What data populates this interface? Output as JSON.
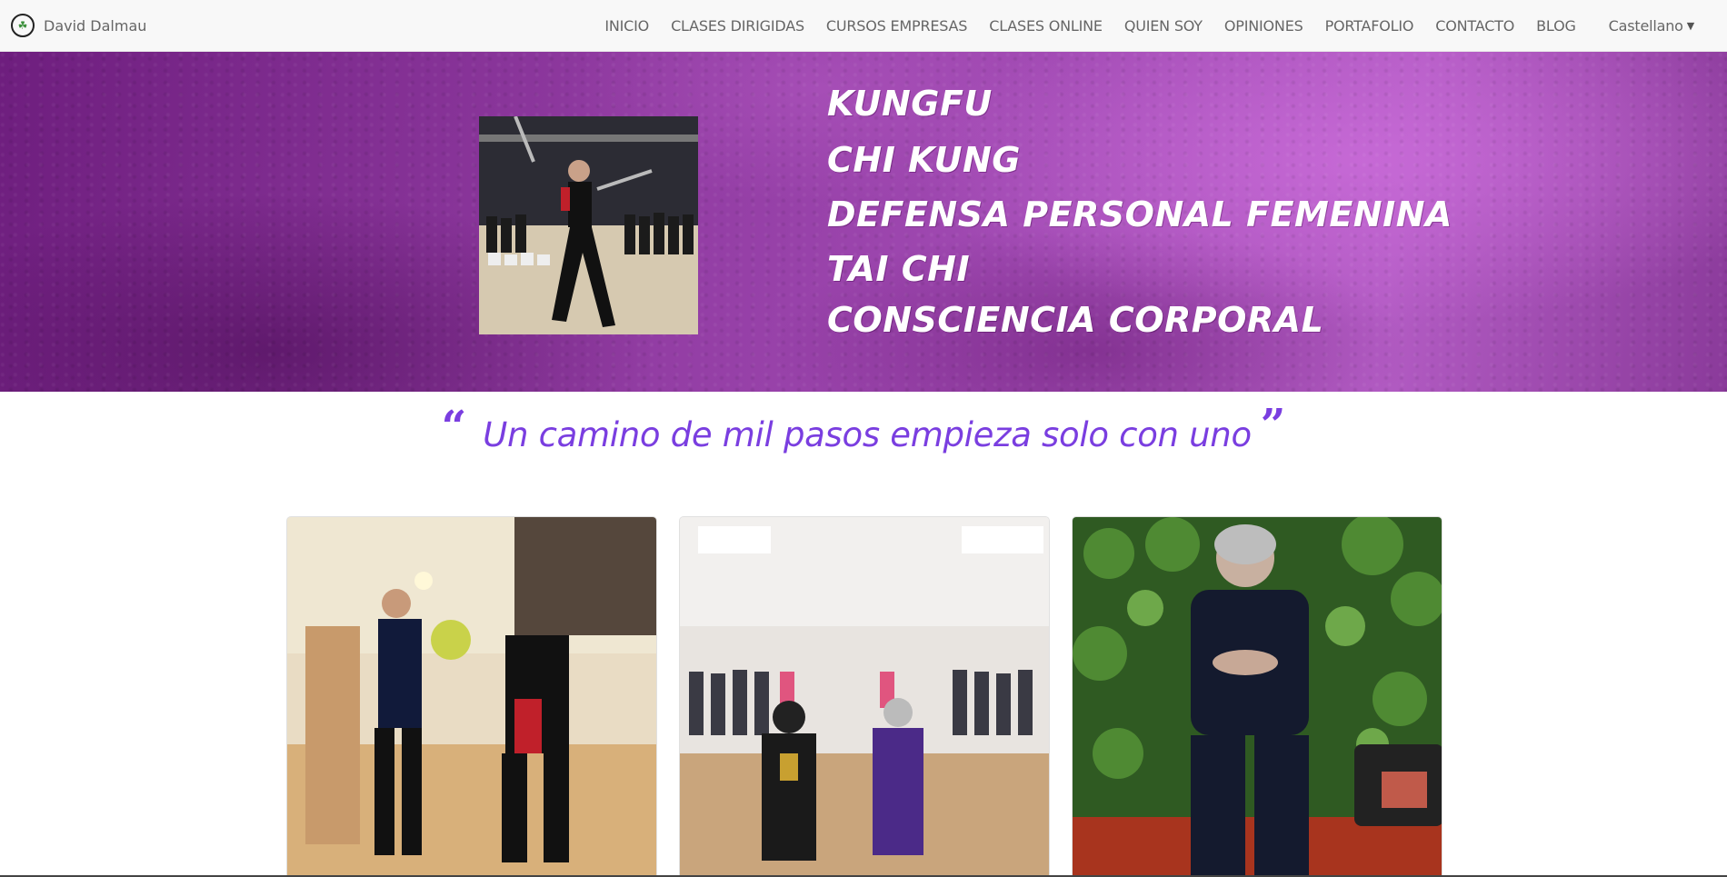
{
  "navbar": {
    "brand_name": "David Dalmau",
    "items": [
      {
        "label": "INICIO"
      },
      {
        "label": "CLASES DIRIGIDAS"
      },
      {
        "label": "CURSOS EMPRESAS"
      },
      {
        "label": "CLASES ONLINE"
      },
      {
        "label": "QUIEN SOY"
      },
      {
        "label": "OPINIONES"
      },
      {
        "label": "PORTAFOLIO"
      },
      {
        "label": "CONTACTO"
      },
      {
        "label": "BLOG"
      }
    ],
    "language": "Castellano"
  },
  "hero": {
    "lines": [
      "KUNGFU",
      "CHI KUNG",
      "DEFENSA PERSONAL FEMENINA",
      "TAI CHI",
      "CONSCIENCIA CORPORAL"
    ],
    "photo_icon": "martial-artist-photo"
  },
  "quote": {
    "text": "Un camino de mil pasos empieza solo con uno",
    "open_mark": "“",
    "close_mark": "”"
  },
  "cards": [
    {
      "icon": "sparring-class-photo"
    },
    {
      "icon": "group-class-photo"
    },
    {
      "icon": "tai-chi-pose-photo"
    }
  ],
  "colors": {
    "accent": "#7a3ee0",
    "hero_purple": "#9a44ad",
    "navbar_bg": "#f8f8f8"
  }
}
